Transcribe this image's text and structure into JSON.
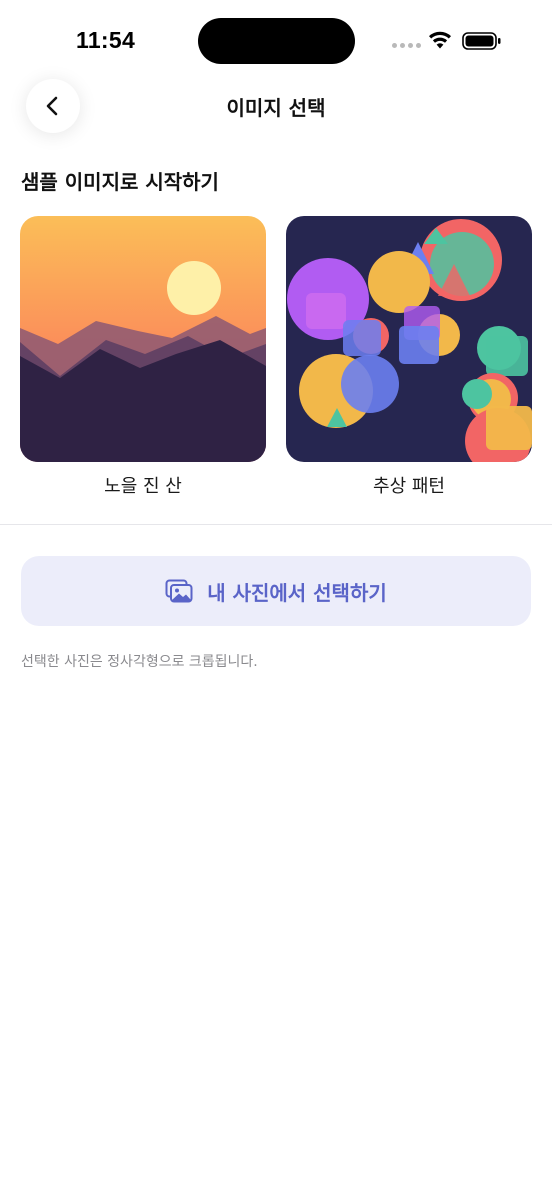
{
  "status_bar": {
    "time": "11:54",
    "icons": [
      "signal-dots",
      "wifi-icon",
      "battery-icon"
    ]
  },
  "nav": {
    "back_icon": "chevron-left-icon",
    "title": "이미지 선택"
  },
  "samples": {
    "heading": "샘플 이미지로 시작하기",
    "items": [
      {
        "label": "노을 진 산",
        "image": "sunset-mountains-image"
      },
      {
        "label": "추상 패턴",
        "image": "abstract-pattern-image"
      }
    ]
  },
  "pick_photo": {
    "icon": "photos-icon",
    "label": "내 사진에서 선택하기"
  },
  "helper_text": "선택한 사진은 정사각형으로 크롭됩니다.",
  "colors": {
    "accent": "#5a64c8",
    "button_bg": "#ecedfa",
    "helper": "#8a8a8e"
  }
}
